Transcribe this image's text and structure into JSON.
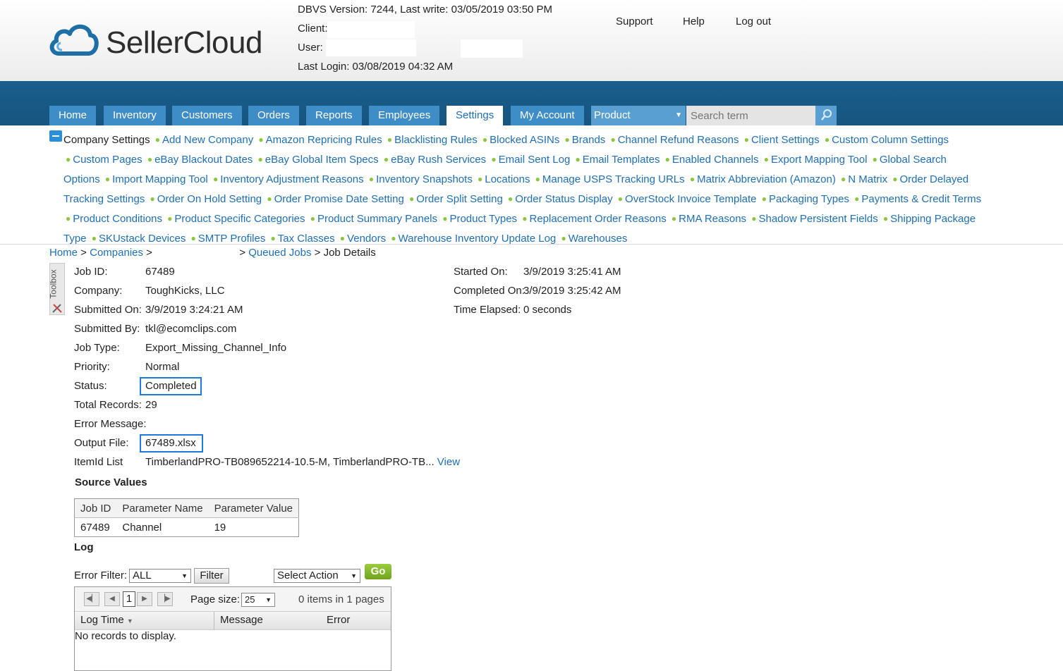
{
  "header": {
    "logo_text": "SellerCloud",
    "dbvs": "DBVS Version: 7244, Last write: 03/05/2019 03:50 PM",
    "client_label": "Client:",
    "user_label": "User:",
    "last_login": "Last Login: 03/08/2019 04:32 AM",
    "links": {
      "support": "Support",
      "help": "Help",
      "logout": "Log out"
    }
  },
  "nav": {
    "tabs": [
      "Home",
      "Inventory",
      "Customers",
      "Orders",
      "Reports",
      "Employees",
      "Settings",
      "My Account"
    ],
    "active_tab": "Settings",
    "search_scope": "Product",
    "search_placeholder": "Search term"
  },
  "settings_menu": {
    "title": "Company Settings",
    "links": [
      "Add New Company",
      "Amazon Repricing Rules",
      "Blacklisting Rules",
      "Blocked ASINs",
      "Brands",
      "Channel Refund Reasons",
      "Client Settings",
      "Custom Column Settings",
      "Custom Pages",
      "eBay Blackout Dates",
      "eBay Global Item Specs",
      "eBay Rush Services",
      "Email Sent Log",
      "Email Templates",
      "Enabled Channels",
      "Export Mapping Tool",
      "Global Search Options",
      "Import Mapping Tool",
      "Inventory Adjustment Reasons",
      "Inventory Snapshots",
      "Locations",
      "Manage USPS Tracking URLs",
      "Matrix Abbreviation (Amazon)",
      "N Matrix",
      "Order Delayed Tracking Settings",
      "Order On Hold Setting",
      "Order Promise Date Setting",
      "Order Split Setting",
      "Order Status Display",
      "OverStock Invoice Template",
      "Packaging Types",
      "Payments & Credit Terms",
      "Product Conditions",
      "Product Specific Categories",
      "Product Summary Panels",
      "Product Types",
      "Replacement Order Reasons",
      "RMA Reasons",
      "Shadow Persistent Fields",
      "Shipping Package Type",
      "SKUstack Devices",
      "SMTP Profiles",
      "Tax Classes",
      "Vendors",
      "Warehouse Inventory Update Log",
      "Warehouses"
    ]
  },
  "breadcrumb": {
    "home": "Home",
    "companies": "Companies",
    "queued_jobs": "Queued Jobs",
    "current": "Job Details"
  },
  "toolbox_label": "Toolbox",
  "job": {
    "job_id_label": "Job ID:",
    "job_id": "67489",
    "company_label": "Company:",
    "company": "ToughKicks, LLC",
    "submitted_on_label": "Submitted On:",
    "submitted_on": "3/9/2019 3:24:21 AM",
    "submitted_by_label": "Submitted By:",
    "submitted_by": "tkl@ecomclips.com",
    "job_type_label": "Job Type:",
    "job_type": "Export_Missing_Channel_Info",
    "priority_label": "Priority:",
    "priority": "Normal",
    "status_label": "Status:",
    "status": "Completed",
    "total_records_label": "Total Records:",
    "total_records": "29",
    "error_message_label": "Error Message:",
    "output_file_label": "Output File:",
    "output_file": "67489.xlsx",
    "itemid_list_label": "ItemId List",
    "itemid_list": "TimberlandPRO-TB089652214-10.5-M, TimberlandPRO-TB...",
    "itemid_view": "View",
    "started_on_label": "Started On:",
    "started_on": "3/9/2019 3:25:41 AM",
    "completed_on_label": "Completed On:",
    "completed_on": "3/9/2019 3:25:42 AM",
    "time_elapsed_label": "Time Elapsed:",
    "time_elapsed": "0 seconds"
  },
  "source_values": {
    "title": "Source Values",
    "columns": [
      "Job ID",
      "Parameter Name",
      "Parameter Value"
    ],
    "rows": [
      [
        "67489",
        "Channel",
        "19"
      ]
    ]
  },
  "log": {
    "title": "Log",
    "error_filter_label": "Error Filter:",
    "error_filter_value": "ALL",
    "filter_button": "Filter",
    "action_select": "Select Action",
    "go_button": "Go",
    "page_number": "1",
    "page_size_label": "Page size:",
    "page_size": "25",
    "items_info": "0 items in 1 pages",
    "columns": [
      "Log Time",
      "Message",
      "Error"
    ],
    "empty_text": "No records to display."
  }
}
